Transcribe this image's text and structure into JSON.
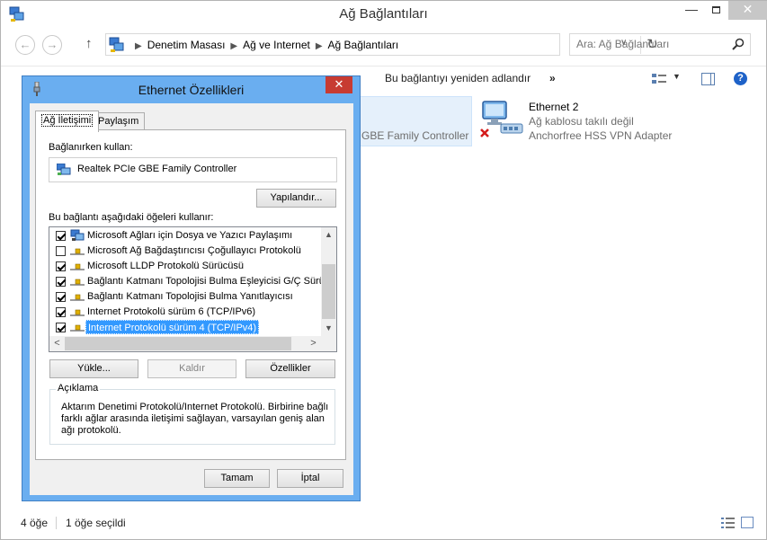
{
  "window": {
    "title": "Ağ Bağlantıları",
    "min_glyph": "—",
    "close_glyph": "✕"
  },
  "nav": {
    "back_glyph": "←",
    "forward_glyph": "→",
    "up_glyph": "↑",
    "breadcrumb": [
      "Denetim Masası",
      "Ağ ve Internet",
      "Ağ Bağlantıları"
    ],
    "separator": "▶",
    "dropdown_glyph": "∨",
    "refresh_glyph": "↻",
    "search_placeholder": "Ara: Ağ Bağlantıları"
  },
  "commandbar": {
    "rename": "Bu bağlantıyı yeniden adlandır",
    "more": "»",
    "view_dropdown_glyph": "▼",
    "help_glyph": "?"
  },
  "connections": [
    {
      "subtitle": "GBE Family Controller"
    },
    {
      "name": "Ethernet 2",
      "status": "Ağ kablosu takılı değil",
      "adapter": "Anchorfree HSS VPN Adapter"
    }
  ],
  "statusbar": {
    "count": "4 öğe",
    "selected": "1 öğe seçildi"
  },
  "dialog": {
    "title": "Ethernet Özellikleri",
    "close_glyph": "✕",
    "tabs": [
      "Ağ İletişimi",
      "Paylaşım"
    ],
    "connect_using_label": "Bağlanırken kullan:",
    "adapter_name": "Realtek PCIe GBE Family Controller",
    "configure_label": "Yapılandır...",
    "items_label": "Bu bağlantı aşağıdaki öğeleri kullanır:",
    "items": [
      {
        "label": "Microsoft Ağları için Dosya ve Yazıcı Paylaşımı",
        "checked": true,
        "icon": "network-service-icon"
      },
      {
        "label": "Microsoft Ağ Bağdaştırıcısı Çoğullayıcı Protokolü",
        "checked": false,
        "icon": "protocol-icon"
      },
      {
        "label": "Microsoft LLDP Protokolü Sürücüsü",
        "checked": true,
        "icon": "protocol-icon"
      },
      {
        "label": "Bağlantı Katmanı Topolojisi Bulma Eşleyicisi G/Ç Sürücü",
        "checked": true,
        "icon": "protocol-icon"
      },
      {
        "label": "Bağlantı Katmanı Topolojisi Bulma Yanıtlayıcısı",
        "checked": true,
        "icon": "protocol-icon"
      },
      {
        "label": "Internet Protokolü sürüm 6 (TCP/IPv6)",
        "checked": true,
        "icon": "protocol-icon"
      },
      {
        "label": "Internet Protokolü sürüm 4 (TCP/IPv4)",
        "checked": true,
        "icon": "protocol-icon",
        "selected": true
      }
    ],
    "scroll_up_glyph": "▲",
    "scroll_down_glyph": "▼",
    "scroll_left_glyph": "<",
    "scroll_right_glyph": ">",
    "install_label": "Yükle...",
    "uninstall_label": "Kaldır",
    "properties_label": "Özellikler",
    "description_title": "Açıklama",
    "description_text": "Aktarım Denetimi Protokolü/Internet Protokolü. Birbirine bağlı farklı ağlar arasında iletişimi sağlayan, varsayılan geniş alan ağı protokolü.",
    "ok_label": "Tamam",
    "cancel_label": "İptal"
  }
}
